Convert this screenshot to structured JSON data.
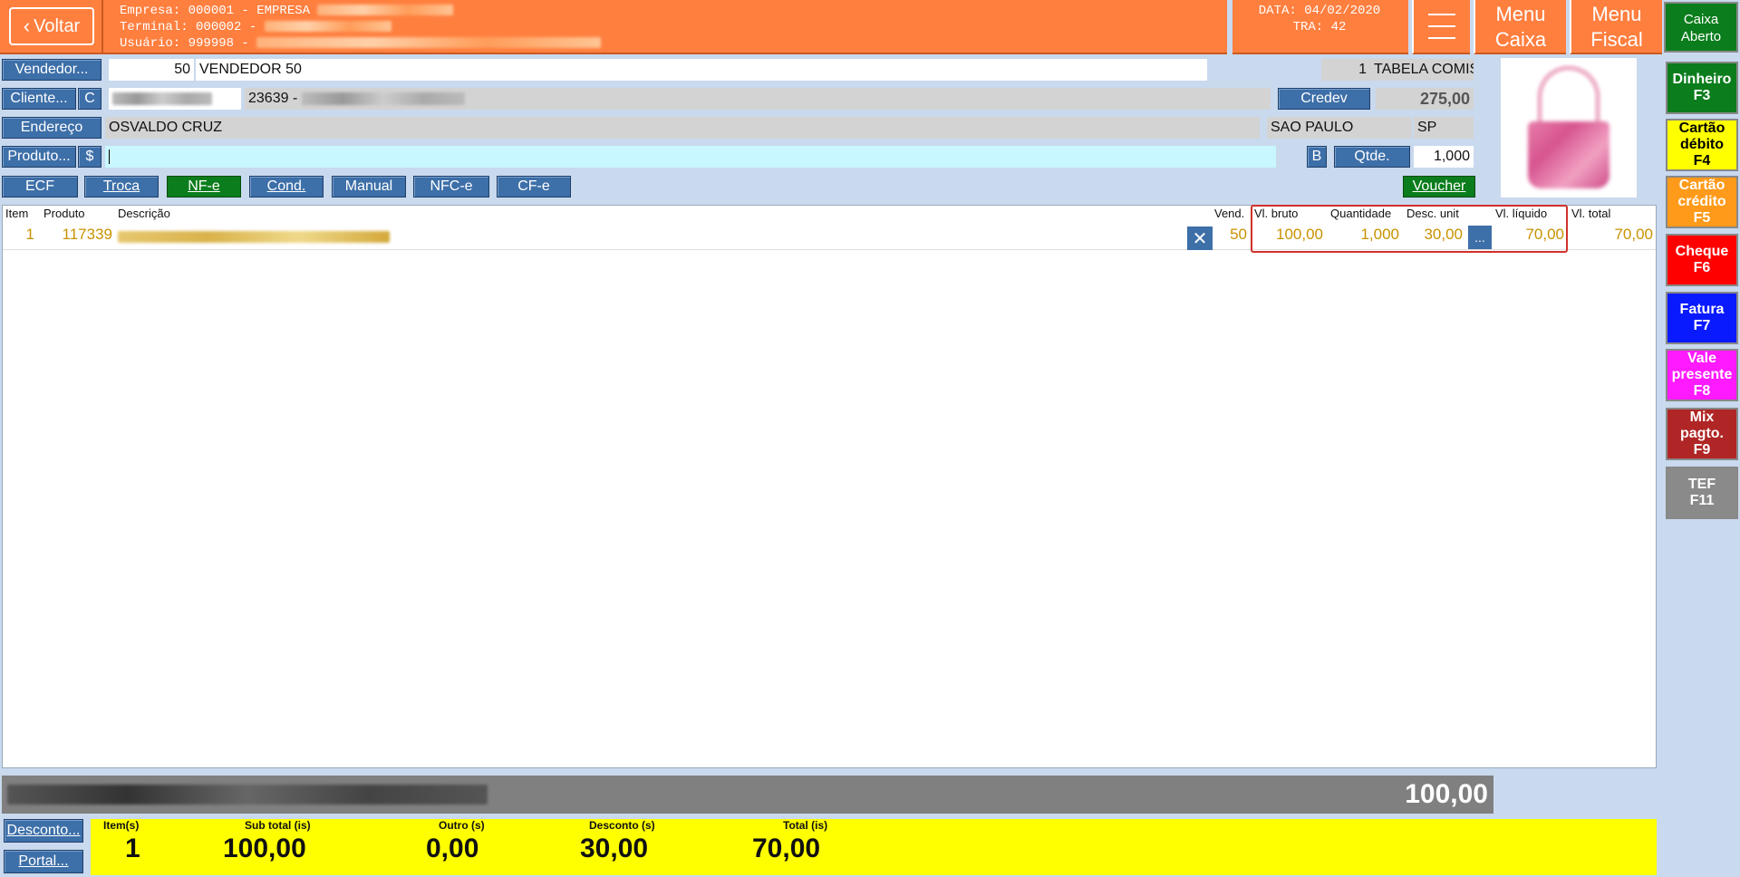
{
  "header": {
    "back_label": "Voltar",
    "empresa": "Empresa: 000001 - EMPRESA",
    "terminal": "Terminal: 000002 -",
    "usuario": "Usuário: 999998 -",
    "data": "DATA: 04/02/2020",
    "tra": "TRA: 42",
    "menu_caixa_l1": "Menu",
    "menu_caixa_l2": "Caixa",
    "menu_fiscal_l1": "Menu",
    "menu_fiscal_l2": "Fiscal",
    "caixa_l1": "Caixa",
    "caixa_l2": "Aberto"
  },
  "form": {
    "vendedor_btn": "Vendedor...",
    "vendedor_code": "50",
    "vendedor_name": "VENDEDOR 50",
    "tabela_num": "1",
    "tabela_name": "TABELA COMIS",
    "cliente_btn": "Cliente...",
    "cliente_c": "C",
    "cliente_code": "23639 -",
    "credev_btn": "Credev",
    "credev_value": "275,00",
    "endereco_btn": "Endereço",
    "endereco": "OSVALDO CRUZ",
    "cidade": "SAO PAULO",
    "uf": "SP",
    "produto_btn": "Produto...",
    "produto_dollar": "$",
    "b_btn": "B",
    "qtde_btn": "Qtde.",
    "qtde_value": "1,000"
  },
  "modes": [
    "ECF",
    "Troca",
    "NF-e",
    "Cond.",
    "Manual",
    "NFC-e",
    "CF-e"
  ],
  "voucher": "Voucher",
  "table": {
    "headers": {
      "item": "Item",
      "produto": "Produto",
      "descricao": "Descrição",
      "vend": "Vend.",
      "vl_bruto": "Vl. bruto",
      "quantidade": "Quantidade",
      "desc_unit": "Desc. unit",
      "vl_liquido": "Vl. líquido",
      "vl_total": "Vl. total"
    },
    "rows": [
      {
        "item": "1",
        "produto": "117339",
        "vend": "50",
        "vl_bruto": "100,00",
        "quantidade": "1,000",
        "desc_unit": "30,00",
        "more": "...",
        "vl_liquido": "70,00",
        "vl_total": "70,00"
      }
    ]
  },
  "status_bar_value": "100,00",
  "bottom": {
    "desconto_btn": "Desconto...",
    "portal_btn": "Portal...",
    "items_label": "Item(s)",
    "items_value": "1",
    "subtotal_label": "Sub total (is)",
    "subtotal_value": "100,00",
    "outro_label": "Outro (s)",
    "outro_value": "0,00",
    "desconto_label": "Desconto (s)",
    "desconto_value": "30,00",
    "total_label": "Total (is)",
    "total_value": "70,00"
  },
  "payments": [
    {
      "l1": "Dinheiro",
      "l2": "F3",
      "l3": "",
      "color": "#0b7d1c",
      "text": "#ffffff"
    },
    {
      "l1": "Cartão",
      "l2": "débito",
      "l3": "F4",
      "color": "#ffff00",
      "text": "#000000"
    },
    {
      "l1": "Cartão",
      "l2": "crédito",
      "l3": "F5",
      "color": "#ff9a1a",
      "text": "#ffffff"
    },
    {
      "l1": "Cheque",
      "l2": "F6",
      "l3": "",
      "color": "#ff0000",
      "text": "#ffffff"
    },
    {
      "l1": "Fatura",
      "l2": "F7",
      "l3": "",
      "color": "#0a1aff",
      "text": "#ffffff"
    },
    {
      "l1": "Vale",
      "l2": "presente",
      "l3": "F8",
      "color": "#ff1aff",
      "text": "#ffffff"
    },
    {
      "l1": "Mix",
      "l2": "pagto.",
      "l3": "F9",
      "color": "#b02525",
      "text": "#ffffff"
    },
    {
      "l1": "TEF",
      "l2": "F11",
      "l3": "",
      "color": "#8a8a8a",
      "text": "#ffffff"
    }
  ]
}
